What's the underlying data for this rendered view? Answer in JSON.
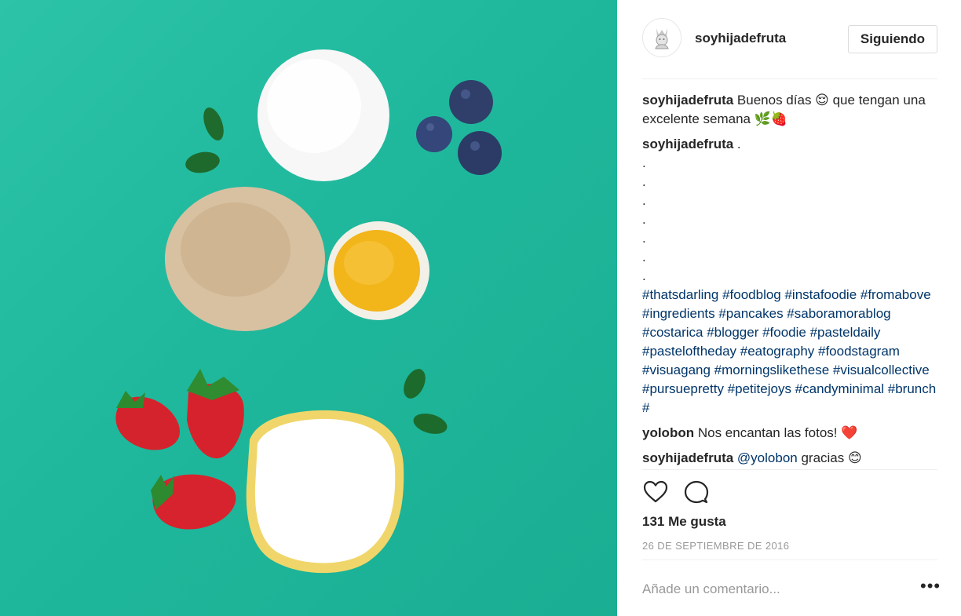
{
  "post": {
    "username": "soyhijadefruta",
    "follow_label": "Siguiendo"
  },
  "comments": [
    {
      "user": "soyhijadefruta",
      "text": " Buenos días 😌 que tengan una excelente semana 🌿🍓"
    }
  ],
  "caption2": {
    "user": "soyhijadefruta",
    "text": " .",
    "dots": [
      ".",
      ".",
      ".",
      ".",
      ".",
      ".",
      "."
    ],
    "hashtags": "#thatsdarling #foodblog #instafoodie #fromabove #ingredients #pancakes #saboramorablog #costarica #blogger #foodie #pasteldaily #pasteloftheday #eatography #foodstagram #visuagang #morningslikethese #visualcollective #pursuepretty #petitejoys #candyminimal #brunch #"
  },
  "comment3": {
    "user": "yolobon",
    "text": " Nos encantan las fotos! ❤️"
  },
  "comment4": {
    "user": "soyhijadefruta",
    "mention": " @yolobon",
    "text": " gracias 😊"
  },
  "likes": "131 Me gusta",
  "date": "26 DE SEPTIEMBRE DE 2016",
  "add_comment_placeholder": "Añade un comentario...",
  "more_label": "•••",
  "icons": {
    "like": "heart-icon",
    "comment": "comment-bubble-icon",
    "more": "more-options-icon"
  },
  "colors": {
    "photo_background": "#1fb89c",
    "hashtag": "#003569",
    "meta": "#999999",
    "text": "#262626"
  }
}
